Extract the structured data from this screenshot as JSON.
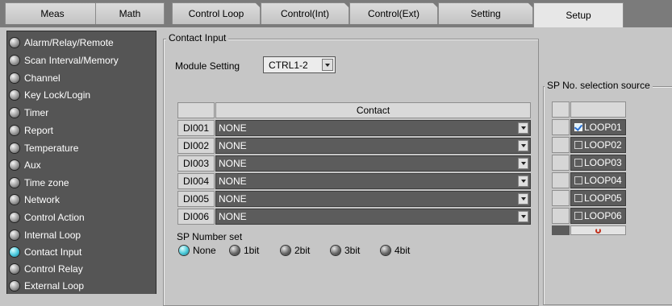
{
  "tabs": [
    {
      "label": "Meas"
    },
    {
      "label": "Math"
    },
    {
      "label": "Control Loop"
    },
    {
      "label": "Control(Int)"
    },
    {
      "label": "Control(Ext)"
    },
    {
      "label": "Setting"
    },
    {
      "label": "Setup"
    }
  ],
  "sidebar": {
    "items": [
      {
        "label": "Alarm/Relay/Remote"
      },
      {
        "label": "Scan Interval/Memory"
      },
      {
        "label": "Channel"
      },
      {
        "label": "Key Lock/Login"
      },
      {
        "label": "Timer"
      },
      {
        "label": "Report"
      },
      {
        "label": "Temperature"
      },
      {
        "label": "Aux"
      },
      {
        "label": "Time zone"
      },
      {
        "label": "Network"
      },
      {
        "label": "Control Action"
      },
      {
        "label": "Internal Loop"
      },
      {
        "label": "Contact Input"
      },
      {
        "label": "Control Relay"
      },
      {
        "label": "External Loop"
      }
    ],
    "active_index": 12
  },
  "contact_input": {
    "group_title": "Contact Input",
    "module_setting_label": "Module Setting",
    "module_setting_value": "CTRL1-2",
    "table_header": "Contact",
    "rows": [
      {
        "id": "DI001",
        "value": "NONE"
      },
      {
        "id": "DI002",
        "value": "NONE"
      },
      {
        "id": "DI003",
        "value": "NONE"
      },
      {
        "id": "DI004",
        "value": "NONE"
      },
      {
        "id": "DI005",
        "value": "NONE"
      },
      {
        "id": "DI006",
        "value": "NONE"
      }
    ],
    "sp_number_set_label": "SP Number set",
    "sp_number_options": [
      "None",
      "1bit",
      "2bit",
      "3bit",
      "4bit"
    ],
    "sp_number_selected": "None"
  },
  "sp_selection": {
    "group_title": "SP No. selection source",
    "loops": [
      {
        "label": "LOOP01",
        "checked": true
      },
      {
        "label": "LOOP02",
        "checked": false
      },
      {
        "label": "LOOP03",
        "checked": false
      },
      {
        "label": "LOOP04",
        "checked": false
      },
      {
        "label": "LOOP05",
        "checked": false
      },
      {
        "label": "LOOP06",
        "checked": false
      }
    ]
  }
}
